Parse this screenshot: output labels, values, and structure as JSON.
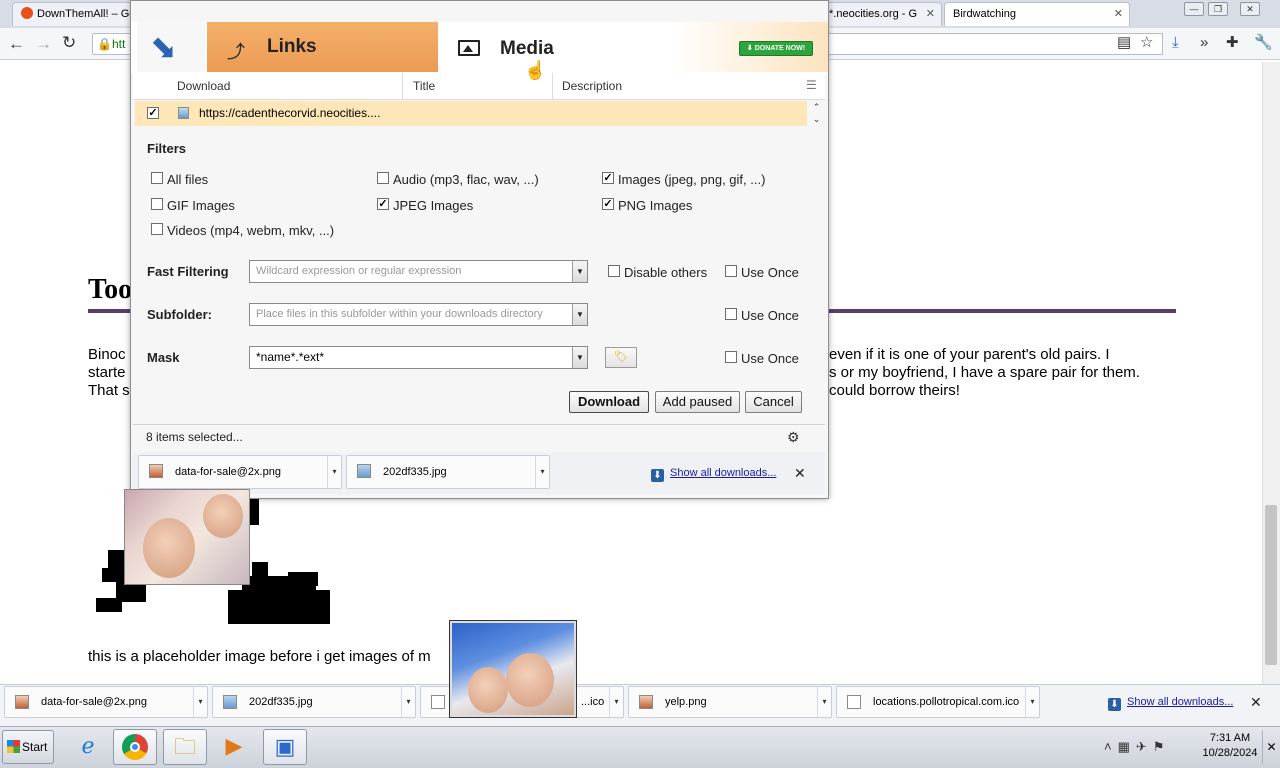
{
  "browser": {
    "tabs": [
      {
        "title": "DownThemAll! – Ge"
      },
      {
        "title": "*.neocities.org - G"
      },
      {
        "title": "Birdwatching"
      }
    ],
    "url_fragment": "htt"
  },
  "page": {
    "heading": "Too",
    "left_text": [
      "Binoc",
      "starte",
      "That s"
    ],
    "right_text": [
      "even if it is one of your parent's old pairs. I",
      "s or my boyfriend, I have a spare pair for them.",
      "could borrow theirs!"
    ],
    "caption": "this is a placeholder image before i get images of m"
  },
  "dialog": {
    "tabs": {
      "links": "Links",
      "media": "Media"
    },
    "donate_label": "DONATE NOW!",
    "columns": [
      "Download",
      "Title",
      "Description"
    ],
    "rows": [
      {
        "checked": true,
        "url": "https://cadenthecorvid.neocities...."
      }
    ],
    "filters": {
      "title": "Filters",
      "options": [
        {
          "label": "All files",
          "checked": false
        },
        {
          "label": "Audio (mp3, flac, wav, ...)",
          "checked": false
        },
        {
          "label": "Images (jpeg, png, gif, ...)",
          "checked": true
        },
        {
          "label": "GIF Images",
          "checked": false
        },
        {
          "label": "JPEG Images",
          "checked": true
        },
        {
          "label": "PNG Images",
          "checked": true
        },
        {
          "label": "Videos (mp4, webm, mkv, ...)",
          "checked": false
        }
      ]
    },
    "fast_filtering": {
      "label": "Fast Filtering",
      "placeholder": "Wildcard expression or regular expression",
      "disable_others": "Disable others",
      "use_once": "Use Once"
    },
    "subfolder": {
      "label": "Subfolder:",
      "placeholder": "Place files in this subfolder within your downloads directory",
      "use_once": "Use Once"
    },
    "mask": {
      "label": "Mask",
      "value": "*name*.*ext*",
      "use_once": "Use Once"
    },
    "buttons": {
      "download": "Download",
      "add_paused": "Add paused",
      "cancel": "Cancel"
    },
    "status": "8 items selected...",
    "shelf": [
      {
        "name": "data-for-sale@2x.png"
      },
      {
        "name": "202df335.jpg"
      }
    ],
    "show_all": "Show all downloads..."
  },
  "shelf": {
    "items": [
      {
        "name": "data-for-sale@2x.png"
      },
      {
        "name": "202df335.jpg"
      },
      {
        "name": "...ico"
      },
      {
        "name": "yelp.png"
      },
      {
        "name": "locations.pollotropical.com.ico"
      }
    ],
    "show_all": "Show all downloads..."
  },
  "taskbar": {
    "start": "Start",
    "time": "7:31 AM",
    "date": "10/28/2024"
  }
}
